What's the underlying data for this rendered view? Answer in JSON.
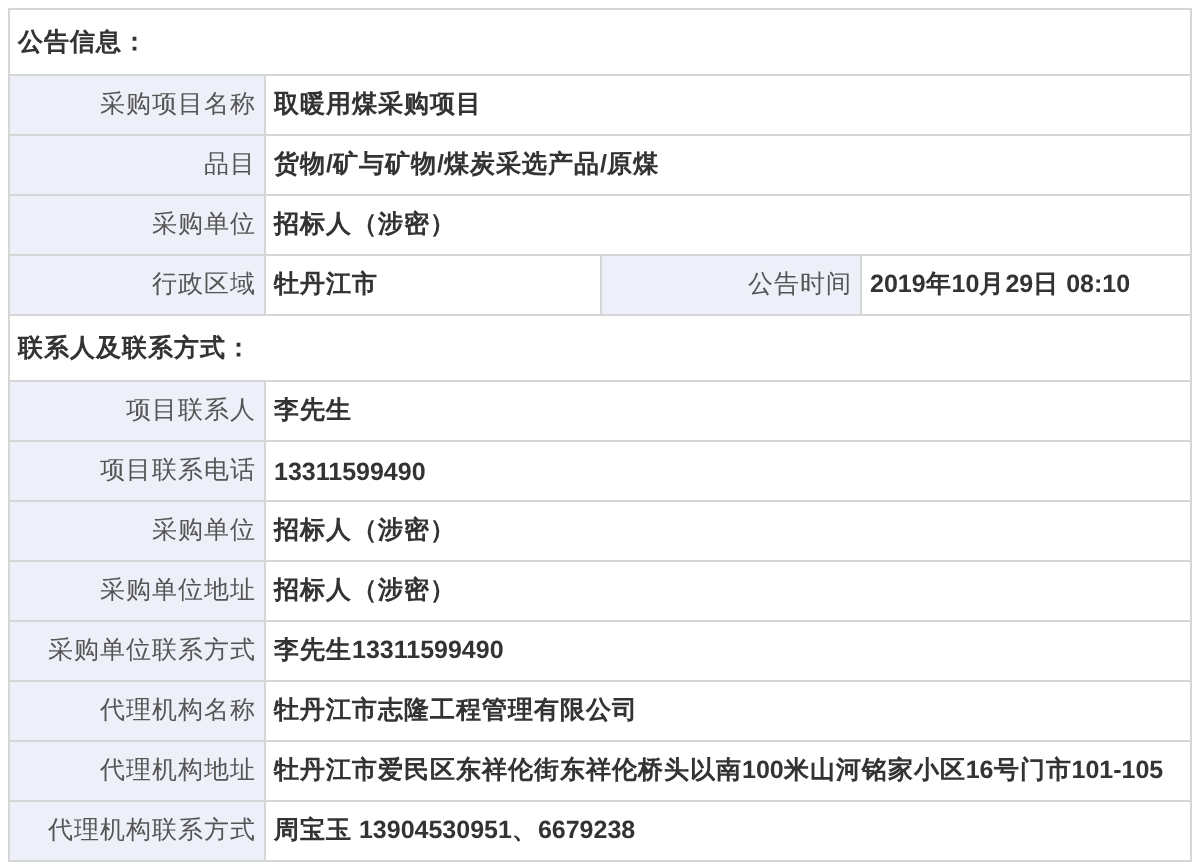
{
  "sections": [
    {
      "title": "公告信息：",
      "rows": [
        {
          "fields": [
            {
              "label": "采购项目名称",
              "value": "取暖用煤采购项目"
            }
          ]
        },
        {
          "fields": [
            {
              "label": "品目",
              "value": "货物/矿与矿物/煤炭采选产品/原煤"
            }
          ]
        },
        {
          "fields": [
            {
              "label": "采购单位",
              "value": "招标人（涉密）"
            }
          ]
        },
        {
          "fields": [
            {
              "label": "行政区域",
              "value": "牡丹江市"
            },
            {
              "label": "公告时间",
              "value": "2019年10月29日 08:10"
            }
          ]
        }
      ]
    },
    {
      "title": "联系人及联系方式：",
      "rows": [
        {
          "fields": [
            {
              "label": "项目联系人",
              "value": "李先生"
            }
          ]
        },
        {
          "fields": [
            {
              "label": "项目联系电话",
              "value": "13311599490"
            }
          ]
        },
        {
          "fields": [
            {
              "label": "采购单位",
              "value": "招标人（涉密）"
            }
          ]
        },
        {
          "fields": [
            {
              "label": "采购单位地址",
              "value": "招标人（涉密）"
            }
          ]
        },
        {
          "fields": [
            {
              "label": "采购单位联系方式",
              "value": "李先生13311599490"
            }
          ]
        },
        {
          "fields": [
            {
              "label": "代理机构名称",
              "value": "牡丹江市志隆工程管理有限公司"
            }
          ]
        },
        {
          "fields": [
            {
              "label": "代理机构地址",
              "value": "牡丹江市爱民区东祥伦街东祥伦桥头以南100米山河铭家小区16号门市101-105"
            }
          ]
        },
        {
          "fields": [
            {
              "label": "代理机构联系方式",
              "value": "周宝玉 13904530951、6679238"
            }
          ]
        }
      ]
    }
  ]
}
